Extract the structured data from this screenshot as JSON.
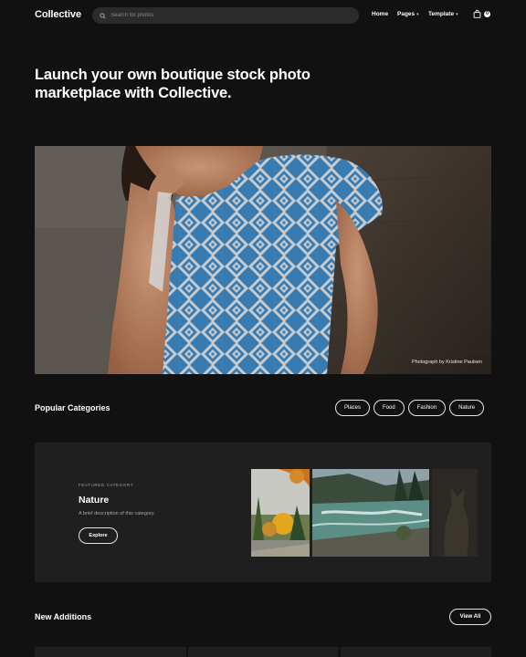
{
  "nav": {
    "logo": "Collective",
    "search_placeholder": "Search for photos",
    "links": [
      {
        "label": "Home",
        "caret": ""
      },
      {
        "label": "Pages",
        "caret": "▾"
      },
      {
        "label": "Template",
        "caret": "▾"
      }
    ],
    "cart_count": "0"
  },
  "hero": {
    "title": "Launch your own boutique stock photo marketplace with Collective.",
    "photo_credit": "Photograph by Kristine Paulsen"
  },
  "categories": {
    "title": "Popular Categories",
    "chips": [
      "Places",
      "Food",
      "Fashion",
      "Nature"
    ],
    "featured": {
      "kicker": "FEATURED CATEGORY",
      "title": "Nature",
      "description": "A brief description of this category.",
      "button": "Explore"
    }
  },
  "new_additions": {
    "title": "New Additions",
    "button": "View All"
  },
  "colors": {
    "background": "#111111",
    "card": "#1f1f1f",
    "search": "#2b2b2b",
    "dress_blue": "#3d86c0"
  }
}
